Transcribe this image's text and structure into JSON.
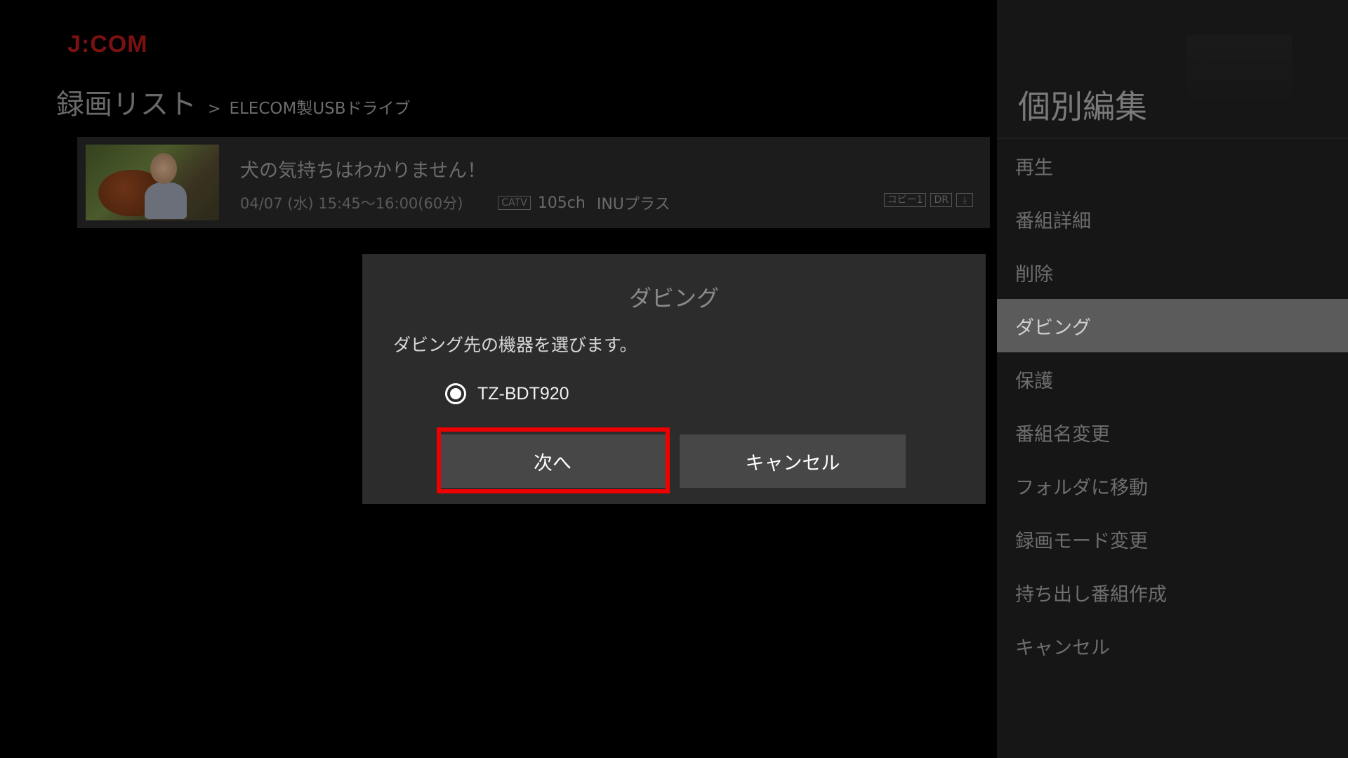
{
  "logo": {
    "text": "J:COM"
  },
  "breadcrumb": {
    "title": "録画リスト",
    "separator": ">",
    "subtitle": "ELECOM製USBドライブ"
  },
  "program": {
    "title": "犬の気持ちはわかりません！",
    "datetime": "04/07 (水) 15:45〜16:00(60分)",
    "network_badge": "CATV",
    "channel": "105ch",
    "station": "INUプラス",
    "badges": [
      "コピー1",
      "DR"
    ],
    "download_icon": "download-icon"
  },
  "dialog": {
    "title": "ダビング",
    "message": "ダビング先の機器を選びます。",
    "options": [
      {
        "label": "TZ-BDT920",
        "selected": true
      }
    ],
    "next_label": "次へ",
    "cancel_label": "キャンセル",
    "focused": "next"
  },
  "side_menu": {
    "title": "個別編集",
    "items": [
      {
        "label": "再生"
      },
      {
        "label": "番組詳細"
      },
      {
        "label": "削除"
      },
      {
        "label": "ダビング",
        "selected": true
      },
      {
        "label": "保護"
      },
      {
        "label": "番組名変更"
      },
      {
        "label": "フォルダに移動"
      },
      {
        "label": "録画モード変更"
      },
      {
        "label": "持ち出し番組作成"
      },
      {
        "label": "キャンセル"
      }
    ]
  },
  "colors": {
    "focus": "#ee0000",
    "logo": "#7a1111",
    "selected_menu": "#5b5b5b",
    "dialog_bg": "#2c2c2c"
  }
}
